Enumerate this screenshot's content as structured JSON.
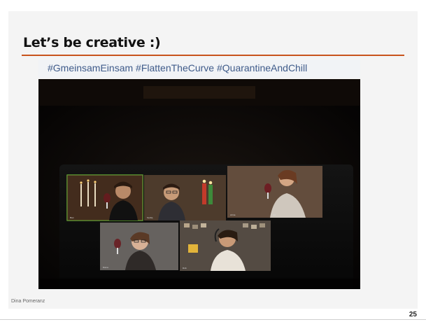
{
  "slide": {
    "title": "Let’s be creative :)",
    "hashtags": "#GmeinsamEinsam #FlattenTheCurve #QuarantineAndChill",
    "author": "Dina Pomeranz",
    "page_number": "25"
  },
  "video_call": {
    "participants": [
      {
        "position": "top-left",
        "highlighted": true
      },
      {
        "position": "top-center",
        "highlighted": false
      },
      {
        "position": "top-right",
        "highlighted": false
      },
      {
        "position": "bottom-left",
        "highlighted": false
      },
      {
        "position": "bottom-right",
        "highlighted": false
      }
    ]
  },
  "colors": {
    "title_rule": "#c8531c",
    "hashtag_text": "#3f5b8a",
    "active_speaker_border": "#6fbf3a"
  }
}
